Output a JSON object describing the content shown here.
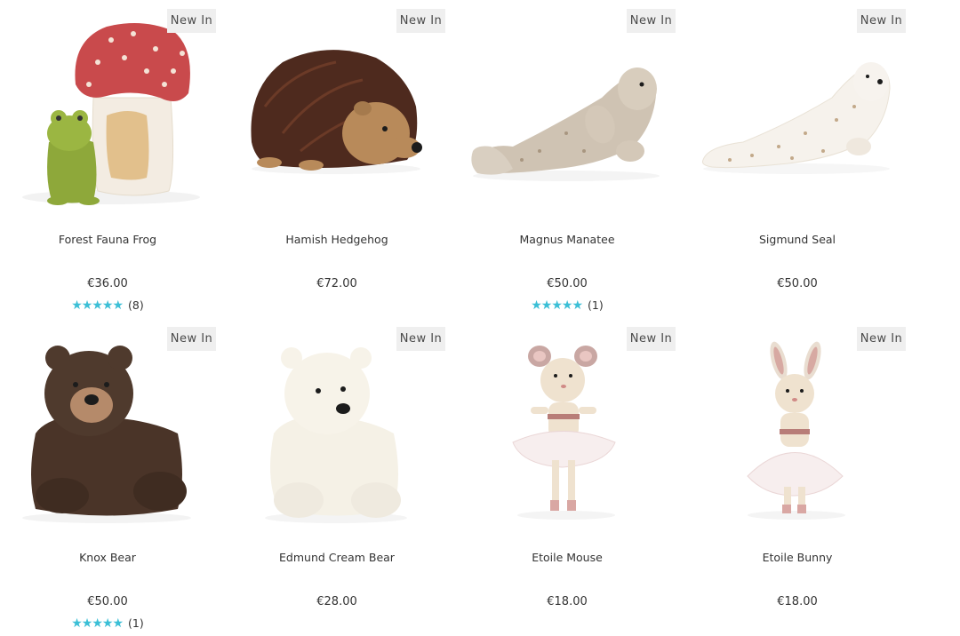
{
  "products": [
    {
      "name": "Forest Fauna Frog",
      "price": "€36.00",
      "badge": "New In",
      "rating_stars": "★★★★★",
      "review_count": "(8)"
    },
    {
      "name": "Hamish Hedgehog",
      "price": "€72.00",
      "badge": "New In"
    },
    {
      "name": "Magnus Manatee",
      "price": "€50.00",
      "badge": "New In",
      "rating_stars": "★★★★★",
      "review_count": "(1)"
    },
    {
      "name": "Sigmund Seal",
      "price": "€50.00",
      "badge": "New In"
    },
    {
      "name": "Knox Bear",
      "price": "€50.00",
      "badge": "New In",
      "rating_stars": "★★★★★",
      "review_count": "(1)"
    },
    {
      "name": "Edmund Cream Bear",
      "price": "€28.00",
      "badge": "New In"
    },
    {
      "name": "Etoile Mouse",
      "price": "€18.00",
      "badge": "New In"
    },
    {
      "name": "Etoile Bunny",
      "price": "€18.00",
      "badge": "New In"
    }
  ],
  "colors": {
    "star": "#3bbfd6",
    "badge_bg": "#efefef"
  }
}
